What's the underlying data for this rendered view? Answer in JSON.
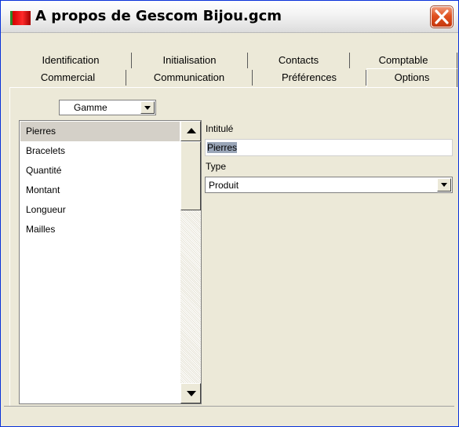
{
  "window": {
    "title": "A propos de Gescom Bijou.gcm",
    "icon": "app-logo-icon",
    "close_icon": "close-icon"
  },
  "tabs_row1": [
    {
      "label": "Identification"
    },
    {
      "label": "Initialisation"
    },
    {
      "label": "Contacts"
    },
    {
      "label": "Comptable"
    }
  ],
  "tabs_row2": [
    {
      "label": "Commercial"
    },
    {
      "label": "Communication"
    },
    {
      "label": "Préférences"
    },
    {
      "label": "Options",
      "active": true
    }
  ],
  "options": {
    "category_select": {
      "value": "Gamme"
    },
    "list": {
      "items": [
        "Pierres",
        "Bracelets",
        "Quantité",
        "Montant",
        "Longueur",
        "Mailles"
      ],
      "selected": "Pierres"
    },
    "intitule_label": "Intitulé",
    "intitule_value": "Pierres",
    "type_label": "Type",
    "type_value": "Produit"
  },
  "colors": {
    "dialog_bg": "#ece9d8",
    "close_button": "#e0511f",
    "selection": "#d4d0c8"
  }
}
